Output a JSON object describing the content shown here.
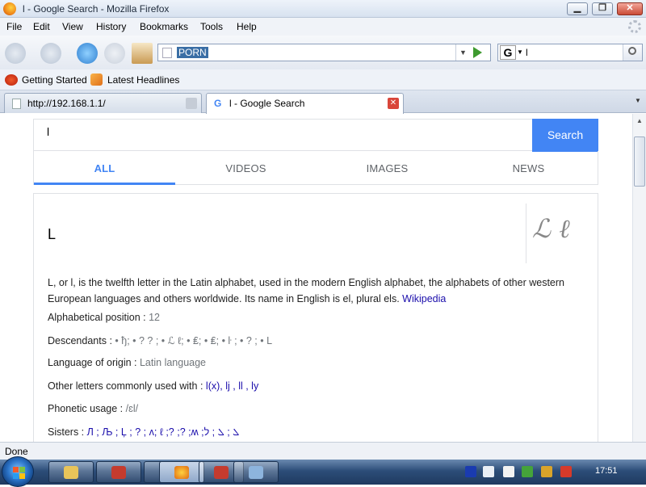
{
  "window": {
    "title": "l - Google Search - Mozilla Firefox",
    "min_label": "▁",
    "max_label": "❐",
    "close_label": "✕"
  },
  "menu": [
    "File",
    "Edit",
    "View",
    "History",
    "Bookmarks",
    "Tools",
    "Help"
  ],
  "navbar": {
    "url_value": "PORN",
    "search_engine": "G",
    "search_value": "l"
  },
  "bookmarks": [
    {
      "label": "Getting Started",
      "icon": "firefox-icon"
    },
    {
      "label": "Latest Headlines",
      "icon": "rss-icon"
    }
  ],
  "tabs": [
    {
      "label": "http://192.168.1.1/"
    },
    {
      "label": "l - Google Search",
      "active": true
    }
  ],
  "google": {
    "query": "l",
    "search_button": "Search",
    "tabs": [
      "ALL",
      "VIDEOS",
      "IMAGES",
      "NEWS"
    ],
    "card": {
      "title": "L",
      "script_glyph": "ℒ ℓ",
      "description": "L, or l, is the twelfth letter in the Latin alphabet, used in the modern English alphabet, the alphabets of other western European languages and others worldwide. Its name in English is el, plural els.",
      "wiki_link": "Wikipedia",
      "facts": [
        {
          "label": "Alphabetical position",
          "value": "12"
        },
        {
          "label": "Descendants",
          "value": "• ђ; • ? ? ; • ℒ ℓ; • ₤; • ₤; • ŀ ; • ? ; • L"
        },
        {
          "label": "Language of origin",
          "value": "Latin language"
        },
        {
          "label": "Other letters commonly used with",
          "value": "l(x), lj , ll , ly"
        },
        {
          "label": "Phonetic usage",
          "value": "/ɛl/"
        },
        {
          "label": "Sisters",
          "value": "Л ; Љ ; Ļ ; ? ; ʌ; ℓ ;? ;? ;ʍ ;ܠ ; ܠ ; ל"
        }
      ]
    }
  },
  "status": "Done",
  "clock": "17:51"
}
